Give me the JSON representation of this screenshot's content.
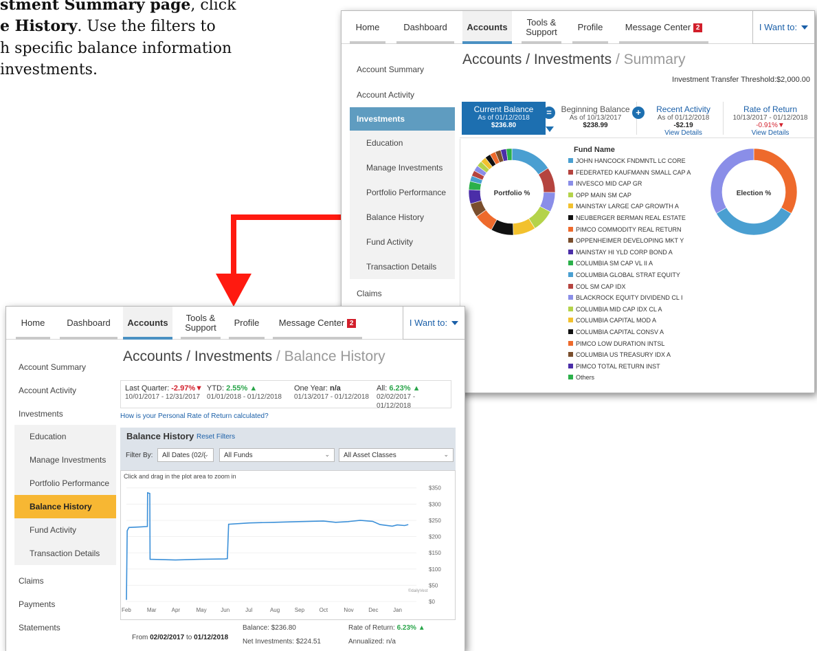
{
  "instruction": {
    "line1_bold": "stment Summary page",
    "line1_rest": ", click",
    "line2_bold": "e History",
    "line2_rest": ". Use the filters to",
    "line3": "h specific balance information",
    "line4": "investments."
  },
  "nav": {
    "home": "Home",
    "dashboard": "Dashboard",
    "accounts": "Accounts",
    "tools_line1": "Tools &",
    "tools_line2": "Support",
    "profile": "Profile",
    "message_center": "Message Center",
    "message_count": "2",
    "i_want_to": "I Want to:"
  },
  "summary": {
    "title_main": "Accounts / Investments",
    "title_muted": " / Summary",
    "threshold": "Investment Transfer Threshold:$2,000.00",
    "sidebar": {
      "account_summary": "Account Summary",
      "account_activity": "Account Activity",
      "investments": "Investments",
      "education": "Education",
      "manage_investments": "Manage Investments",
      "portfolio_performance": "Portfolio Performance",
      "balance_history": "Balance History",
      "fund_activity": "Fund Activity",
      "transaction_details": "Transaction Details",
      "claims": "Claims"
    },
    "tickets": {
      "current": {
        "title": "Current Balance",
        "asof": "As of 01/12/2018",
        "value": "$236.80"
      },
      "beginning": {
        "title": "Beginning Balance",
        "asof": "As of 10/13/2017",
        "value": "$238.99"
      },
      "recent": {
        "title": "Recent Activity",
        "asof": "As of 01/12/2018",
        "value": "-$2.19",
        "link": "View Details"
      },
      "rate": {
        "title": "Rate of Return",
        "asof": "10/13/2017 - 01/12/2018",
        "value": "-0.91%",
        "link": "View Details"
      }
    },
    "portfolio_label": "Portfolio %",
    "election_label": "Election %",
    "fund_header": "Fund Name",
    "funds": [
      {
        "name": "JOHN HANCOCK FNDMNTL LC CORE",
        "color": "#4a9fd1"
      },
      {
        "name": "FEDERATED KAUFMANN SMALL CAP A",
        "color": "#b5443f"
      },
      {
        "name": "INVESCO MID CAP GR",
        "color": "#8a8ee8"
      },
      {
        "name": "OPP MAIN SM CAP",
        "color": "#b4d34a"
      },
      {
        "name": "MAINSTAY LARGE CAP GROWTH A",
        "color": "#f2c12e"
      },
      {
        "name": "NEUBERGER BERMAN REAL ESTATE",
        "color": "#111111"
      },
      {
        "name": "PIMCO COMMODITY REAL RETURN",
        "color": "#ee6a2c"
      },
      {
        "name": "OPPENHEIMER DEVELOPING MKT Y",
        "color": "#7a4e2d"
      },
      {
        "name": "MAINSTAY HI YLD CORP BOND A",
        "color": "#4b2ea8"
      },
      {
        "name": "COLUMBIA SM CAP VL II A",
        "color": "#2bb04a"
      },
      {
        "name": "COLUMBIA GLOBAL STRAT EQUITY",
        "color": "#4a9fd1"
      },
      {
        "name": "COL SM CAP IDX",
        "color": "#b5443f"
      },
      {
        "name": "BLACKROCK EQUITY DIVIDEND CL I",
        "color": "#8a8ee8"
      },
      {
        "name": "COLUMBIA MID CAP IDX CL A",
        "color": "#b4d34a"
      },
      {
        "name": "COLUMBIA CAPITAL MOD A",
        "color": "#f2c12e"
      },
      {
        "name": "COLUMBIA CAPITAL CONSV A",
        "color": "#111111"
      },
      {
        "name": "PIMCO LOW DURATION INTSL",
        "color": "#ee6a2c"
      },
      {
        "name": "COLUMBIA US TREASURY IDX A",
        "color": "#7a4e2d"
      },
      {
        "name": "PIMCO TOTAL RETURN INST",
        "color": "#4b2ea8"
      },
      {
        "name": "Others",
        "color": "#2bb04a"
      }
    ]
  },
  "history": {
    "title_main": "Accounts / Investments",
    "title_muted": " / Balance History",
    "sidebar": {
      "account_summary": "Account Summary",
      "account_activity": "Account Activity",
      "investments": "Investments",
      "education": "Education",
      "manage_investments": "Manage Investments",
      "portfolio_performance": "Portfolio Performance",
      "balance_history": "Balance History",
      "fund_activity": "Fund Activity",
      "transaction_details": "Transaction Details",
      "claims": "Claims",
      "payments": "Payments",
      "statements": "Statements"
    },
    "kpis": {
      "last_quarter_label": "Last Quarter: ",
      "last_quarter_value": "-2.97%",
      "last_quarter_dates": "10/01/2017 - 12/31/2017",
      "ytd_label": "YTD: ",
      "ytd_value": "2.55%",
      "ytd_dates": "01/01/2018 - 01/12/2018",
      "one_year_label": "One Year: ",
      "one_year_value": "n/a",
      "one_year_dates": "01/13/2017 - 01/12/2018",
      "all_label": "All: ",
      "all_value": "6.23%",
      "all_dates": "02/02/2017 - 01/12/2018"
    },
    "ror_link": "How is your Personal Rate of Return calculated?",
    "section_title": "Balance History",
    "reset_filters": "Reset Filters",
    "filter_by": "Filter By:",
    "filter_dates": "All Dates (02/(",
    "filter_funds": "All Funds",
    "filter_assets": "All Asset Classes",
    "zoom_hint": "Click and drag in the plot area to zoom in",
    "watermark": "©dailyVest",
    "stats": {
      "from_prefix": "From ",
      "from_date": "02/02/2017",
      "to_word": " to ",
      "to_date": "01/12/2018",
      "balance_label": "Balance: ",
      "balance_value": "$236.80",
      "net_label": "Net Investments: ",
      "net_value": "$224.51",
      "ror_label": "Rate of Return: ",
      "ror_value": "6.23%",
      "annualized_label": "Annualized: ",
      "annualized_value": "n/a"
    }
  },
  "chart_data": {
    "type": "line",
    "title": "",
    "xlabel": "",
    "ylabel": "",
    "categories": [
      "Feb",
      "Mar",
      "Apr",
      "May",
      "Jun",
      "Jul",
      "Aug",
      "Sep",
      "Oct",
      "Nov",
      "Dec",
      "Jan"
    ],
    "yticks": [
      "$0",
      "$50",
      "$100",
      "$150",
      "$200",
      "$250",
      "$300",
      "$350"
    ],
    "ylim": [
      0,
      360
    ],
    "y_axis_side": "right",
    "series": [
      {
        "values_by_month_index": [
          [
            0.0,
            5
          ],
          [
            0.03,
            218
          ],
          [
            0.1,
            228
          ],
          [
            0.6,
            230
          ],
          [
            0.85,
            231
          ],
          [
            0.86,
            335
          ],
          [
            0.95,
            333
          ],
          [
            0.96,
            130
          ],
          [
            2.0,
            128
          ],
          [
            3.0,
            130
          ],
          [
            4.0,
            131
          ],
          [
            4.1,
            132
          ],
          [
            4.15,
            238
          ],
          [
            5.0,
            242
          ],
          [
            6.0,
            244
          ],
          [
            7.0,
            246
          ],
          [
            8.0,
            248
          ],
          [
            8.5,
            244
          ],
          [
            9.0,
            246
          ],
          [
            9.5,
            250
          ],
          [
            10.0,
            247
          ],
          [
            10.3,
            237
          ],
          [
            10.8,
            232
          ],
          [
            11.0,
            236
          ],
          [
            11.3,
            234
          ],
          [
            11.45,
            237
          ]
        ]
      }
    ]
  },
  "colors": {
    "accent_blue": "#1d6fb0",
    "sidebar_active_blue": "#5f9cc0",
    "sidebar_active_gold": "#f7b733",
    "negative": "#d21f2b",
    "positive": "#2aa54a",
    "line": "#3a8fd8",
    "arrow": "#ff1a10"
  }
}
